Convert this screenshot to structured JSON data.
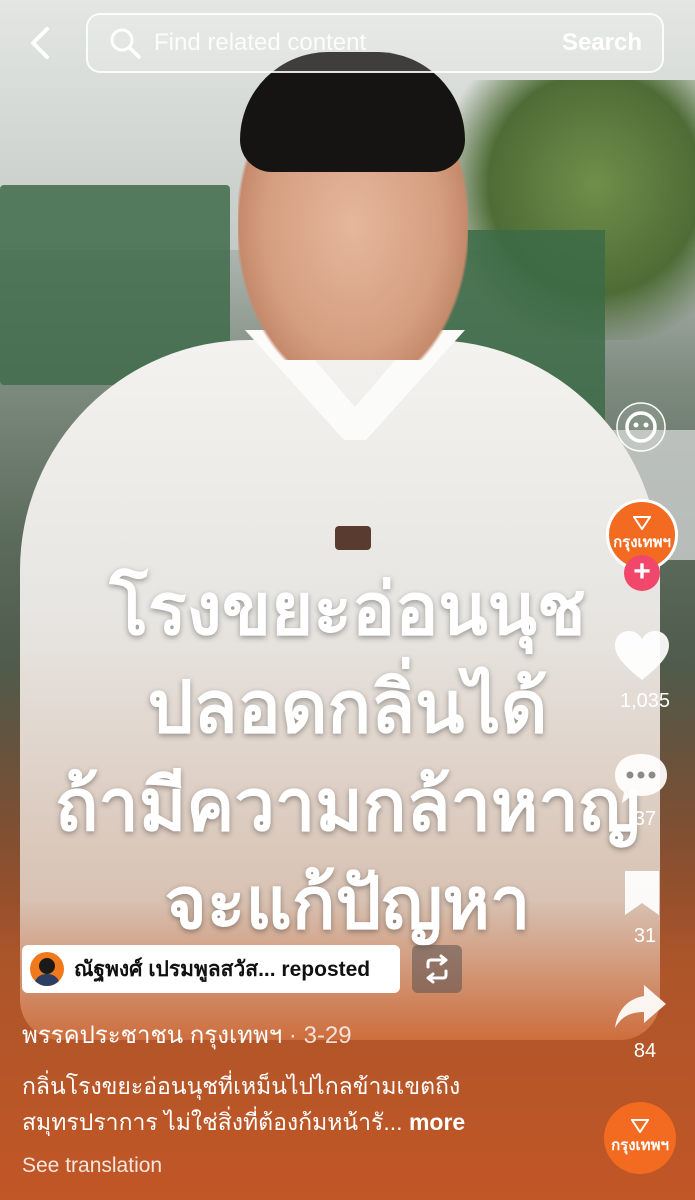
{
  "topbar": {
    "search_placeholder": "Find related content",
    "search_button": "Search"
  },
  "video": {
    "overlay_lines": [
      "โรงขยะอ่อนนุช",
      "ปลอดกลิ่นได้",
      "ถ้ามีความกล้าหาญ",
      "จะแก้ปัญหา"
    ]
  },
  "rail": {
    "creator_badge": "กรุงเทพฯ",
    "likes": "1,035",
    "comments": "37",
    "saves": "31",
    "shares": "84",
    "sound_badge": "กรุงเทพฯ"
  },
  "repost": {
    "label": "ณัฐพงศ์ เปรมพูลสวัส... reposted"
  },
  "post": {
    "author": "พรรคประชาชน กรุงเทพฯ",
    "date": " · 3-29",
    "caption_line1": "กลิ่นโรงขยะอ่อนนุชที่เหม็นไปไกลข้ามเขตถึง",
    "caption_line2": "สมุทรปราการ ไม่ใช่สิ่งที่ต้องก้มหน้ารั...",
    "more": " more",
    "see_translation": "See translation"
  },
  "colors": {
    "brand_orange": "#f26b21",
    "follow_pink": "#f0476b"
  }
}
